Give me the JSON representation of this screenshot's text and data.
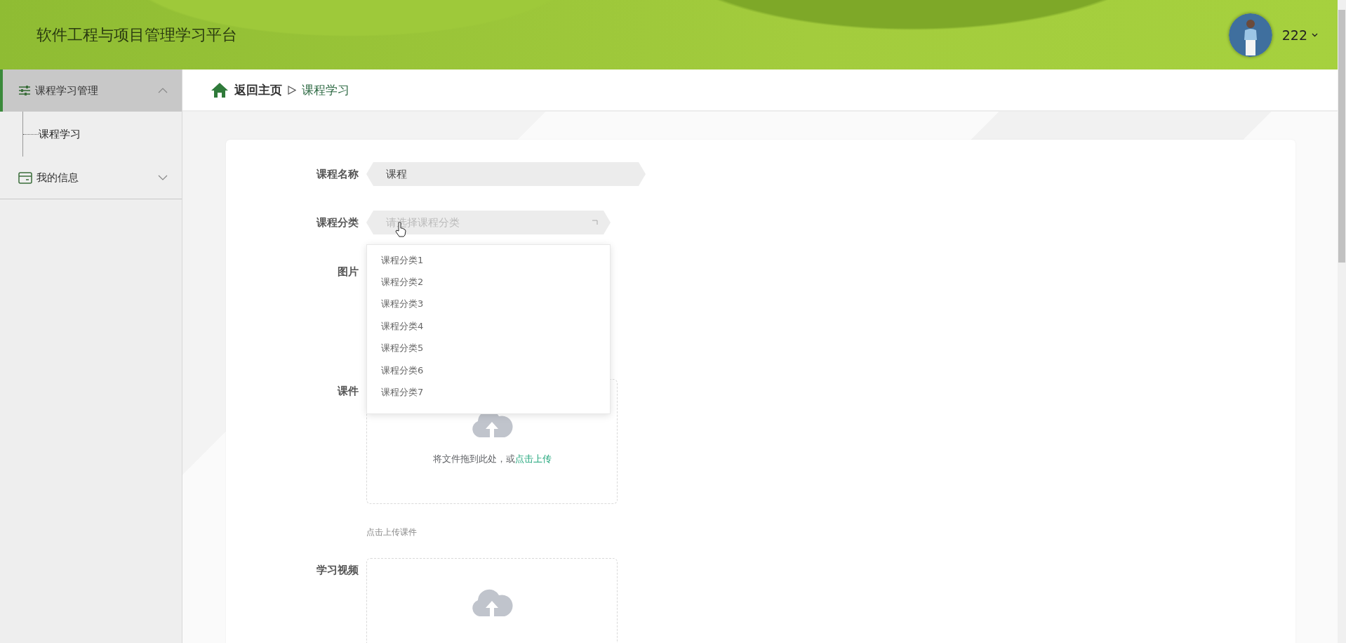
{
  "header": {
    "title": "软件工程与项目管理学习平台",
    "user": "222"
  },
  "sidebar": {
    "items": [
      {
        "label": "课程学习管理",
        "expanded": true,
        "selected": true,
        "children": [
          {
            "label": "课程学习"
          }
        ]
      },
      {
        "label": "我的信息",
        "expanded": false,
        "selected": false
      }
    ]
  },
  "breadcrumb": {
    "home": "返回主页",
    "current": "课程学习"
  },
  "form": {
    "fields": [
      {
        "kind": "text",
        "label": "课程名称",
        "value": "课程"
      },
      {
        "kind": "select",
        "label": "课程分类",
        "placeholder": "请选择课程分类",
        "expanded": true,
        "options": [
          "课程分类1",
          "课程分类2",
          "课程分类3",
          "课程分类4",
          "课程分类5",
          "课程分类6",
          "课程分类7"
        ]
      },
      {
        "kind": "image",
        "label": "图片"
      },
      {
        "kind": "upload",
        "label": "课件",
        "drop_text": "将文件拖到此处，或",
        "link": "点击上传",
        "tip": "点击上传课件"
      },
      {
        "kind": "upload",
        "label": "学习视频"
      }
    ]
  }
}
